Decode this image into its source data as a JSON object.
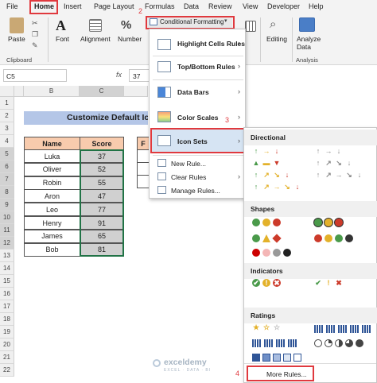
{
  "ribbon": {
    "tabs": [
      "File",
      "Home",
      "Insert",
      "Page Layout",
      "Formulas",
      "Data",
      "Review",
      "View",
      "Developer",
      "Help"
    ],
    "buttons": {
      "paste": "Paste",
      "font": "Font",
      "alignment": "Alignment",
      "number": "Number",
      "conditional_formatting": "Conditional Formatting",
      "editing": "Editing",
      "analyze_data": "Analyze Data"
    },
    "groups": {
      "clipboard": "Clipboard",
      "analysis": "Analysis"
    }
  },
  "formula_bar": {
    "name_box": "C5",
    "value": "37",
    "fx": "fx"
  },
  "grid": {
    "columns": [
      "B",
      "C"
    ],
    "rows": [
      "1",
      "2",
      "3",
      "4",
      "5",
      "6",
      "7",
      "8",
      "9",
      "10",
      "11",
      "12",
      "13",
      "14",
      "15",
      "16",
      "17",
      "18",
      "19",
      "20",
      "21",
      "22"
    ],
    "title": "Customize Default Ic",
    "headers": [
      "Name",
      "Score"
    ],
    "data": [
      [
        "Luka",
        "37"
      ],
      [
        "Oliver",
        "52"
      ],
      [
        "Robin",
        "55"
      ],
      [
        "Aron",
        "47"
      ],
      [
        "Leo",
        "77"
      ],
      [
        "Henry",
        "91"
      ],
      [
        "James",
        "65"
      ],
      [
        "Bob",
        "81"
      ]
    ],
    "partial_header": "F"
  },
  "cf_menu": {
    "items": [
      "Highlight Cells Rules",
      "Top/Bottom Rules",
      "Data Bars",
      "Color Scales",
      "Icon Sets",
      "New Rule...",
      "Clear Rules",
      "Manage Rules..."
    ]
  },
  "icon_sets": {
    "sections": [
      "Directional",
      "Shapes",
      "Indicators",
      "Ratings"
    ],
    "more_rules": "More Rules..."
  },
  "step_labels": [
    "1",
    "2",
    "3",
    "4"
  ],
  "watermark": {
    "name": "exceldemy",
    "tagline": "EXCEL · DATA · BI"
  },
  "colors": {
    "green": "#4a9a4a",
    "yellow": "#e3b12a",
    "red": "#cc3a2a",
    "gray": "#8a8a8a",
    "accent_red": "#e0393e",
    "header_fill": "#f8cbad",
    "title_fill": "#b4c6e7"
  }
}
